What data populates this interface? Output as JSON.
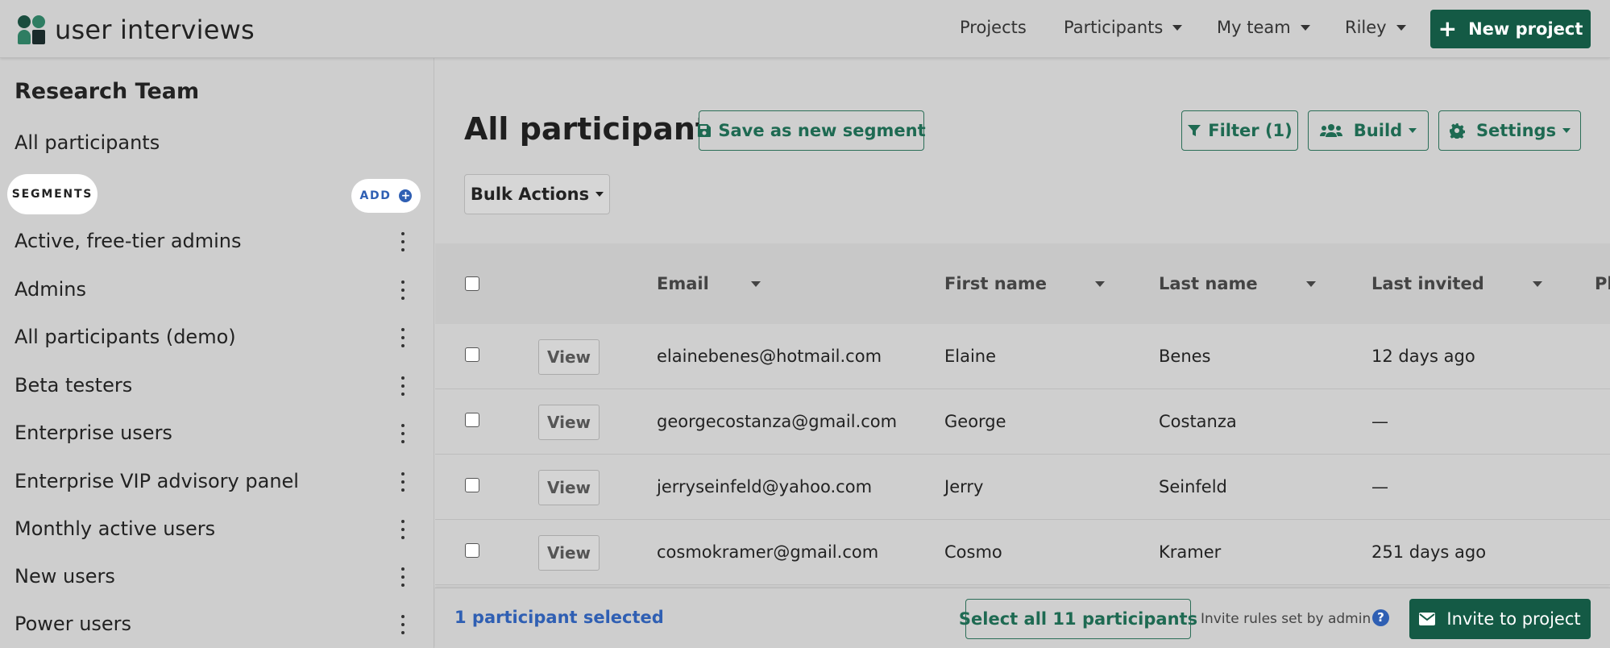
{
  "app": {
    "logo_text": "user interviews",
    "colors": {
      "brand": "#145a45",
      "link": "#2f5fb3"
    }
  },
  "nav": {
    "projects": "Projects",
    "participants": "Participants",
    "my_team": "My team",
    "user": "Riley",
    "new_project": "New project"
  },
  "sidebar": {
    "team": "Research Team",
    "all_participants": "All participants",
    "segments_label": "SEGMENTS",
    "add_label": "ADD",
    "segments": [
      "Active, free-tier admins",
      "Admins",
      "All participants (demo)",
      "Beta testers",
      "Enterprise users",
      "Enterprise VIP advisory panel",
      "Monthly active users",
      "New users",
      "Power users"
    ]
  },
  "main": {
    "title": "All participants",
    "save_segment": "Save as new segment",
    "filter": "Filter (1)",
    "build": "Build",
    "settings": "Settings",
    "bulk_actions": "Bulk Actions"
  },
  "table": {
    "columns": [
      "Email",
      "First name",
      "Last name",
      "Last invited",
      "Ph"
    ],
    "view_label": "View",
    "rows": [
      {
        "email": "elainebenes@hotmail.com",
        "first": "Elaine",
        "last": "Benes",
        "invited": "12 days ago"
      },
      {
        "email": "georgecostanza@gmail.com",
        "first": "George",
        "last": "Costanza",
        "invited": "—"
      },
      {
        "email": "jerryseinfeld@yahoo.com",
        "first": "Jerry",
        "last": "Seinfeld",
        "invited": "—"
      },
      {
        "email": "cosmokramer@gmail.com",
        "first": "Cosmo",
        "last": "Kramer",
        "invited": "251 days ago"
      }
    ]
  },
  "footer": {
    "selected": "1 participant selected",
    "select_all": "Select all 11 participants",
    "rules": "Invite rules set by admin",
    "help": "?",
    "invite": "Invite to project"
  }
}
